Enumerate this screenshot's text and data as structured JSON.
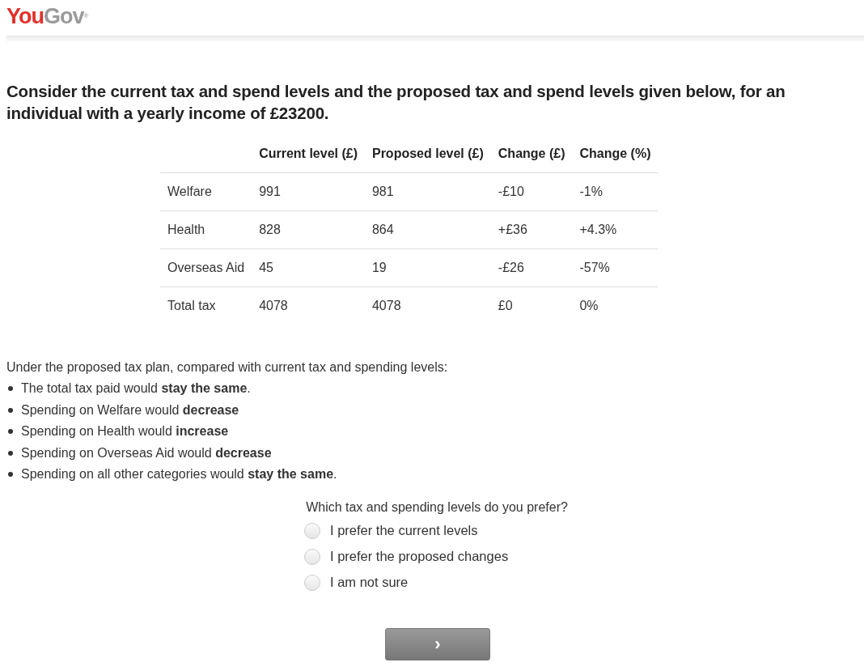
{
  "logo": {
    "first": "You",
    "second": "Gov",
    "mark": "®"
  },
  "question": "Consider the current tax and spend levels and the proposed tax and spend levels given below, for an individual with a yearly income of £23200.",
  "table": {
    "columns": [
      "",
      "Current level (£)",
      "Proposed level (£)",
      "Change (£)",
      "Change (%)"
    ],
    "rows": [
      [
        "Welfare",
        "991",
        "981",
        "-£10",
        "-1%"
      ],
      [
        "Health",
        "828",
        "864",
        "+£36",
        "+4.3%"
      ],
      [
        "Overseas Aid",
        "45",
        "19",
        "-£26",
        "-57%"
      ],
      [
        "Total tax",
        "4078",
        "4078",
        "£0",
        "0%"
      ]
    ]
  },
  "summary_intro": "Under the proposed tax plan, compared with current tax and spending levels:",
  "summary_items": [
    "The total tax paid would **stay the same**.",
    "Spending on Welfare would **decrease**",
    "Spending on Health would **increase**",
    "Spending on Overseas Aid would **decrease**",
    "Spending on all other categories would **stay the same**."
  ],
  "prompt": "Which tax and spending levels do you prefer?",
  "options": [
    {
      "label": "I prefer the current levels",
      "selected": false
    },
    {
      "label": "I prefer the proposed changes",
      "selected": false
    },
    {
      "label": "I am not sure",
      "selected": false
    }
  ],
  "next_button": "›"
}
